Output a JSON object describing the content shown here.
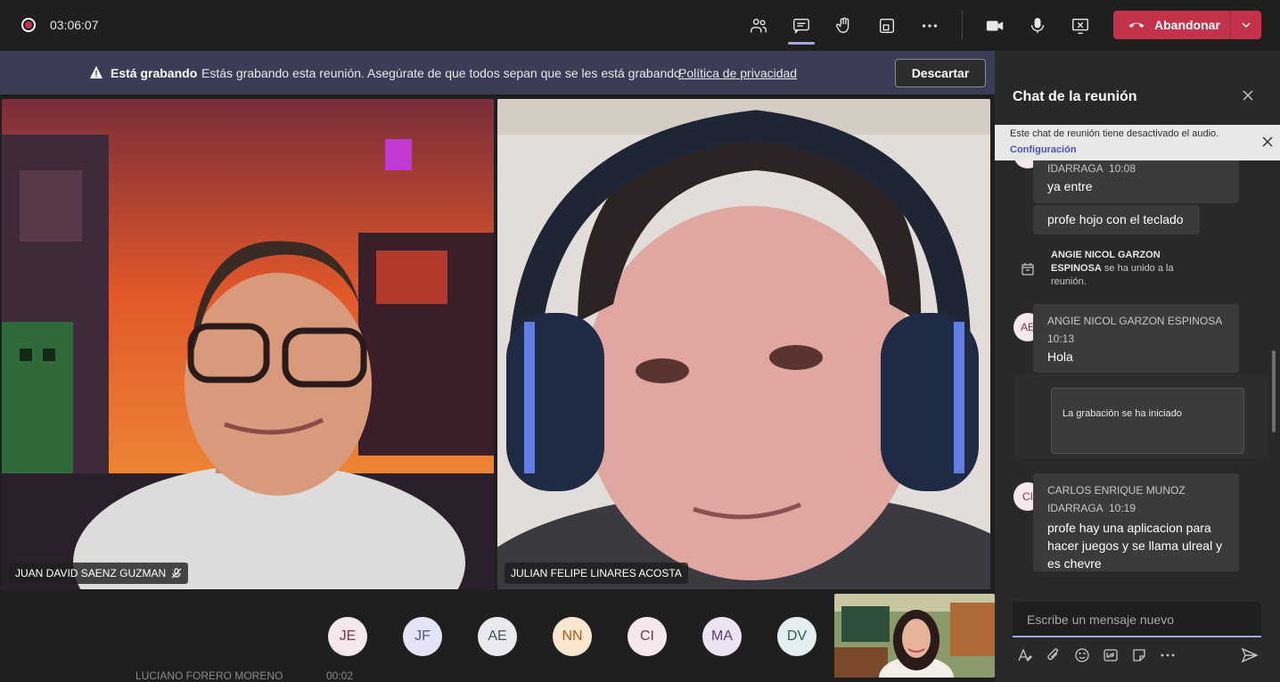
{
  "toolbar": {
    "timer": "03:06:07",
    "leave_label": "Abandonar"
  },
  "banner": {
    "title": "Está grabando",
    "message": "Estás grabando esta reunión. Asegúrate de que todos sepan que se les está grabando.",
    "link": "Política de privacidad",
    "dismiss": "Descartar"
  },
  "videos": [
    {
      "name": "JUAN DAVID SAENZ GUZMAN",
      "muted": true
    },
    {
      "name": "JULIAN FELIPE LINARES ACOSTA",
      "muted": false
    }
  ],
  "participants": [
    {
      "initials": "JE",
      "bg": "#f4e8ec",
      "fg": "#7a3a4b"
    },
    {
      "initials": "JF",
      "bg": "#e4e4f6",
      "fg": "#4f52b2"
    },
    {
      "initials": "AE",
      "bg": "#e8eaf0",
      "fg": "#4a5161"
    },
    {
      "initials": "NN",
      "bg": "#fbe6d0",
      "fg": "#a35f1c"
    },
    {
      "initials": "CI",
      "bg": "#f4e8ec",
      "fg": "#7a3a4b"
    },
    {
      "initials": "MA",
      "bg": "#ece4f4",
      "fg": "#5a3a7a"
    },
    {
      "initials": "DV",
      "bg": "#e4eef0",
      "fg": "#2f5a63"
    }
  ],
  "peek_row": {
    "name": "LUCIANO FORERO MORENO",
    "time": "00:02"
  },
  "chat": {
    "title": "Chat de la reunión",
    "notice": "Este chat de reunión tiene desactivado el audio.",
    "notice_link": "Configuración",
    "msg1": {
      "author": "IDARRAGA",
      "time": "10:08",
      "lines": [
        "ya entre",
        "profe hojo con el teclado"
      ]
    },
    "join": {
      "name": "ANGIE NICOL GARZON ESPINOSA",
      "text": "se ha unido a la reunión."
    },
    "msg2": {
      "initials": "AE",
      "author": "ANGIE NICOL GARZON ESPINOSA",
      "time": "10:13",
      "text": "Hola"
    },
    "recording_card": "La grabación se ha iniciado",
    "msg3": {
      "initials": "CI",
      "author_line1": "CARLOS ENRIQUE MUNOZ",
      "author_line2": "IDARRAGA",
      "time": "10:19",
      "text": "profe hay una aplicacion para hacer juegos y se llama ulreal y es chevre"
    },
    "compose_placeholder": "Escribe un mensaje nuevo"
  },
  "colors": {
    "accent": "#a6a7dc",
    "leave": "#c4314b",
    "banner": "#3b3d56"
  }
}
